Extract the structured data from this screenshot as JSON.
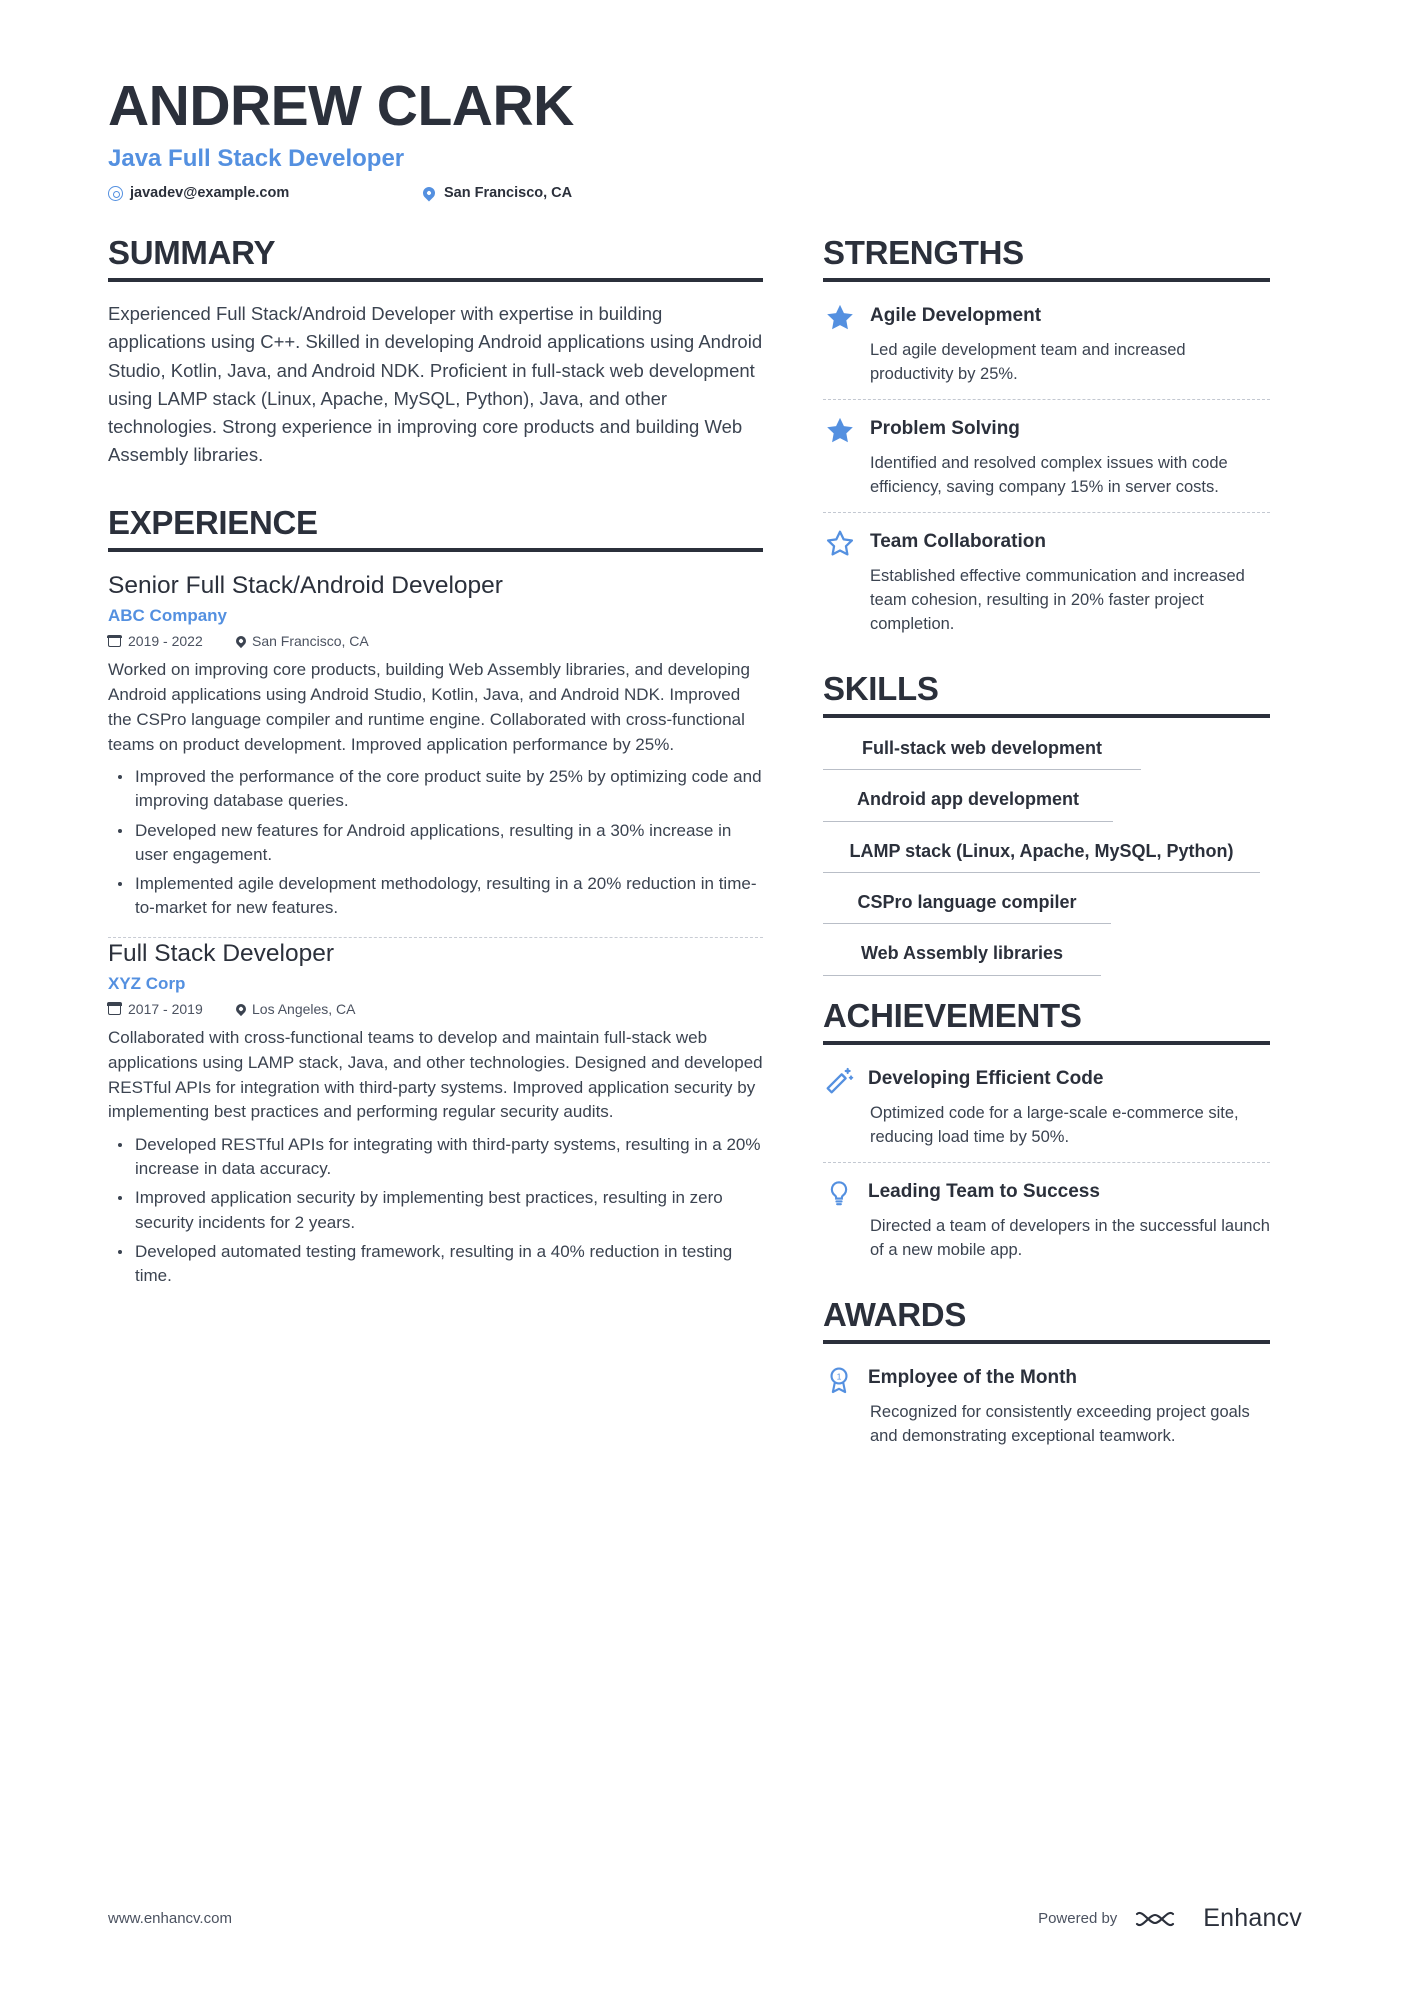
{
  "header": {
    "name": "ANDREW CLARK",
    "job_title": "Java Full Stack Developer",
    "email": "javadev@example.com",
    "location": "San Francisco, CA",
    "accent_color": "#5490e0",
    "heading_color": "#2b303b"
  },
  "summary": {
    "title": "SUMMARY",
    "text": "Experienced Full Stack/Android Developer with expertise in building applications using C++. Skilled in developing Android applications using Android Studio, Kotlin, Java, and Android NDK. Proficient in full-stack web development using LAMP stack (Linux, Apache, MySQL, Python), Java, and other technologies. Strong experience in improving core products and building Web Assembly libraries."
  },
  "experience": {
    "title": "EXPERIENCE",
    "jobs": [
      {
        "role": "Senior Full Stack/Android Developer",
        "company": "ABC Company",
        "dates": "2019 - 2022",
        "location": "San Francisco, CA",
        "description": "Worked on improving core products, building Web Assembly libraries, and developing Android applications using Android Studio, Kotlin, Java, and Android NDK. Improved the CSPro language compiler and runtime engine. Collaborated with cross-functional teams on product development. Improved application performance by 25%.",
        "bullets": [
          "Improved the performance of the core product suite by 25% by optimizing code and improving database queries.",
          "Developed new features for Android applications, resulting in a 30% increase in user engagement.",
          "Implemented agile development methodology, resulting in a 20% reduction in time-to-market for new features."
        ]
      },
      {
        "role": "Full Stack Developer",
        "company": "XYZ Corp",
        "dates": "2017 - 2019",
        "location": "Los Angeles, CA",
        "description": "Collaborated with cross-functional teams to develop and maintain full-stack web applications using LAMP stack, Java, and other technologies. Designed and developed RESTful APIs for integration with third-party systems. Improved application security by implementing best practices and performing regular security audits.",
        "bullets": [
          "Developed RESTful APIs for integrating with third-party systems, resulting in a 20% increase in data accuracy.",
          "Improved application security by implementing best practices, resulting in zero security incidents for 2 years.",
          "Developed automated testing framework, resulting in a 40% reduction in testing time."
        ]
      }
    ]
  },
  "strengths": {
    "title": "STRENGTHS",
    "items": [
      {
        "icon": "star-filled-icon",
        "title": "Agile Development",
        "text": "Led agile development team and increased productivity by 25%."
      },
      {
        "icon": "star-filled-icon",
        "title": "Problem Solving",
        "text": "Identified and resolved complex issues with code efficiency, saving company 15% in server costs."
      },
      {
        "icon": "star-outline-icon",
        "title": "Team Collaboration",
        "text": "Established effective communication and increased team cohesion, resulting in 20% faster project completion."
      }
    ]
  },
  "skills": {
    "title": "SKILLS",
    "items": [
      "Full-stack web development",
      "Android app development",
      "LAMP stack (Linux, Apache, MySQL, Python)",
      "CSPro language compiler",
      "Web Assembly libraries"
    ]
  },
  "achievements": {
    "title": "ACHIEVEMENTS",
    "items": [
      {
        "icon": "magic-wand-icon",
        "title": "Developing Efficient Code",
        "text": "Optimized code for a large-scale e-commerce site, reducing load time by 50%."
      },
      {
        "icon": "lightbulb-icon",
        "title": "Leading Team to Success",
        "text": "Directed a team of developers in the successful launch of a new mobile app."
      }
    ]
  },
  "awards": {
    "title": "AWARDS",
    "items": [
      {
        "icon": "award-medal-icon",
        "title": "Employee of the Month",
        "text": "Recognized for consistently exceeding project goals and demonstrating exceptional teamwork."
      }
    ]
  },
  "footer": {
    "website": "www.enhancv.com",
    "powered_by": "Powered by",
    "brand": "Enhancv"
  }
}
